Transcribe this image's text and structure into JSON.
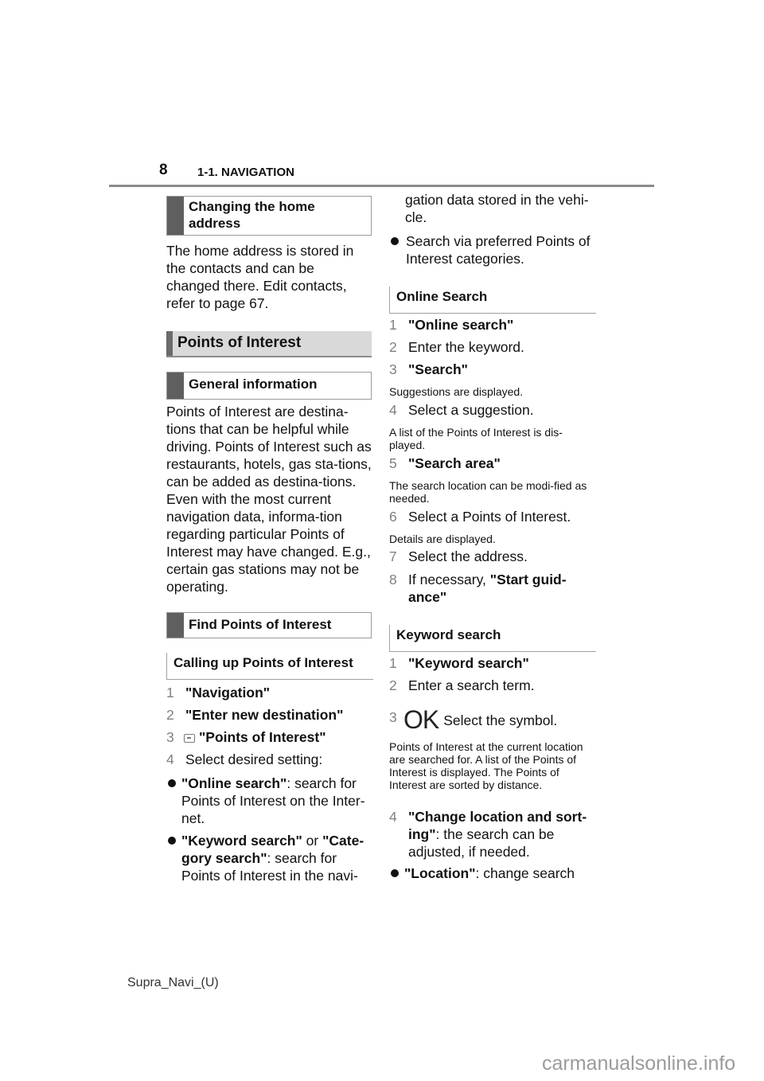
{
  "header": {
    "page_number": "8",
    "section": "1-1. NAVIGATION"
  },
  "left": {
    "h_changing_home": "Changing the home address",
    "p_home": "The home address is stored in the contacts and can be changed there. Edit contacts, refer to page 67.",
    "h_poi": "Points of Interest",
    "h_general": "General information",
    "p_general": "Points of Interest are destina-tions that can be helpful while driving. Points of Interest such as restaurants, hotels, gas sta-tions, can be added as destina-tions. Even with the most current navigation data, informa-tion regarding particular Points of Interest may have changed. E.g., certain gas stations may not be operating.",
    "h_find": "Find Points of Interest",
    "h_calling": "Calling up Points of Interest",
    "steps": [
      {
        "num": "1",
        "bold": "\"Navigation\""
      },
      {
        "num": "2",
        "bold": "\"Enter new destination\""
      },
      {
        "num": "3",
        "icon": "poi-list-icon",
        "bold": "\"Points of Interest\""
      },
      {
        "num": "4",
        "text": "Select desired setting:"
      }
    ],
    "bullets": [
      {
        "bold": "\"Online search\"",
        "text": ": search for Points of Interest on the Inter-net."
      },
      {
        "bold": "\"Keyword search\"",
        "mid": " or ",
        "bold2": "\"Cate-gory search\"",
        "text": ": search for Points of Interest in the navi-"
      }
    ]
  },
  "right": {
    "cont_text": "gation data stored in the vehi-cle.",
    "bullet_pref": "Search via preferred Points of Interest categories.",
    "h_online": "Online Search",
    "online_steps": [
      {
        "num": "1",
        "bold": "\"Online search\""
      },
      {
        "num": "2",
        "text": "Enter the keyword."
      },
      {
        "num": "3",
        "bold": "\"Search\""
      },
      {
        "note": "Suggestions are displayed."
      },
      {
        "num": "4",
        "text": "Select a suggestion."
      },
      {
        "note": "A list of the Points of Interest is dis-played."
      },
      {
        "num": "5",
        "bold": "\"Search area\""
      },
      {
        "note": "The search location can be modi-fied as needed."
      },
      {
        "num": "6",
        "text": "Select a Points of Interest."
      },
      {
        "note": "Details are displayed."
      },
      {
        "num": "7",
        "text": "Select the address."
      },
      {
        "num": "8",
        "text": "If necessary, ",
        "bold": "\"Start guid-ance\""
      }
    ],
    "h_keyword": "Keyword search",
    "keyword_steps": [
      {
        "num": "1",
        "bold": "\"Keyword search\""
      },
      {
        "num": "2",
        "text": "Enter a search term."
      },
      {
        "num": "3",
        "icon_text": "OK",
        "text": "Select the symbol."
      },
      {
        "note": "Points of Interest at the current location are searched for. A list of the Points of Interest is displayed. The Points of Interest are sorted by distance."
      },
      {
        "num": "4",
        "bold": "\"Change location and sort-ing\"",
        "text": ": the search can be adjusted, if needed."
      }
    ],
    "bullet_location": {
      "bold": "\"Location\"",
      "text": ": change search"
    }
  },
  "footer": {
    "doc_id": "Supra_Navi_(U)",
    "watermark": "carmanualsonline.info"
  }
}
